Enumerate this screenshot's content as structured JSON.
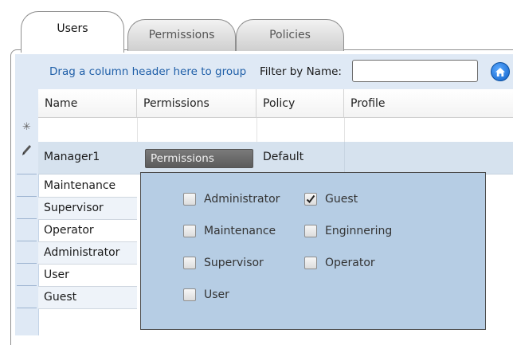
{
  "tabs": [
    {
      "label": "Users",
      "active": true
    },
    {
      "label": "Permissions",
      "active": false
    },
    {
      "label": "Policies",
      "active": false
    }
  ],
  "groupbar": {
    "hint": "Drag a column header here to group",
    "filter_label": "Filter by Name:",
    "filter_value": "",
    "home_icon": "home-icon"
  },
  "columns": [
    "Name",
    "Permissions",
    "Policy",
    "Profile"
  ],
  "row_markers": {
    "new_row": "✳",
    "edit_row": "pencil-icon"
  },
  "edited_row": {
    "name": "Manager1",
    "permissions": "Permissions",
    "policy": "Default",
    "profile": ""
  },
  "rows": [
    "Maintenance",
    "Supervisor",
    "Operator",
    "Administrator",
    "User",
    "Guest"
  ],
  "permissions_popup": {
    "options": [
      {
        "label": "Administrator",
        "checked": false
      },
      {
        "label": "Guest",
        "checked": true
      },
      {
        "label": "Maintenance",
        "checked": false
      },
      {
        "label": "Enginnering",
        "checked": false
      },
      {
        "label": "Supervisor",
        "checked": false
      },
      {
        "label": "Operator",
        "checked": false
      },
      {
        "label": "User",
        "checked": false
      }
    ]
  },
  "colors": {
    "accent": "#1f5fa8",
    "header_bg": "#dfe9f5",
    "popup_bg": "#b6cde4",
    "edit_row_bg": "#d6e2ee"
  }
}
